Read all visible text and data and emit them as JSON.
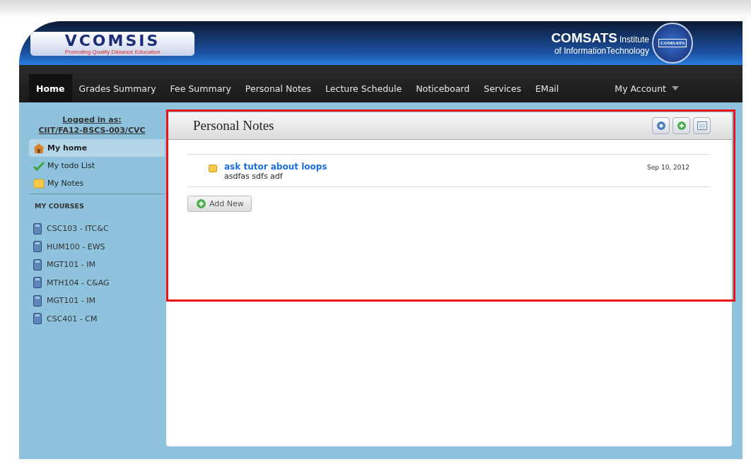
{
  "header": {
    "logo_text": "VCOMSIS",
    "logo_tagline": "Promoting Quality Distance Education",
    "institute_name": "COMSATS",
    "institute_suffix": "Institute",
    "institute_line2": "of InformationTechnology",
    "emblem_text": "COMSATS"
  },
  "nav": {
    "items": [
      {
        "label": "Home",
        "selected": true
      },
      {
        "label": "Grades Summary",
        "selected": false
      },
      {
        "label": "Fee Summary",
        "selected": false
      },
      {
        "label": "Personal Notes",
        "selected": false
      },
      {
        "label": "Lecture Schedule",
        "selected": false
      },
      {
        "label": "Noticeboard",
        "selected": false
      },
      {
        "label": "Services",
        "selected": false
      },
      {
        "label": "EMail",
        "selected": false
      }
    ],
    "account": "My Account"
  },
  "sidebar": {
    "logged_in_label": "Logged in as:",
    "user_id": "CIIT/FA12-BSCS-003/CVC",
    "items": [
      {
        "label": "My home",
        "kind": "home",
        "selected": true
      },
      {
        "label": "My todo List",
        "kind": "todo",
        "selected": false
      },
      {
        "label": "My Notes",
        "kind": "notes",
        "selected": false
      }
    ],
    "courses_heading": "MY COURSES",
    "courses": [
      "CSC103 - ITC&C",
      "HUM100 - EWS",
      "MGT101 - IM",
      "MTH104 - C&AG",
      "MGT101 - IM",
      "CSC401 - CM"
    ]
  },
  "panel": {
    "title": "Personal Notes",
    "notes": [
      {
        "title": "ask tutor about loops",
        "body": "asdfas sdfs adf",
        "date": "Sep 10, 2012"
      }
    ],
    "add_button": "Add New"
  }
}
